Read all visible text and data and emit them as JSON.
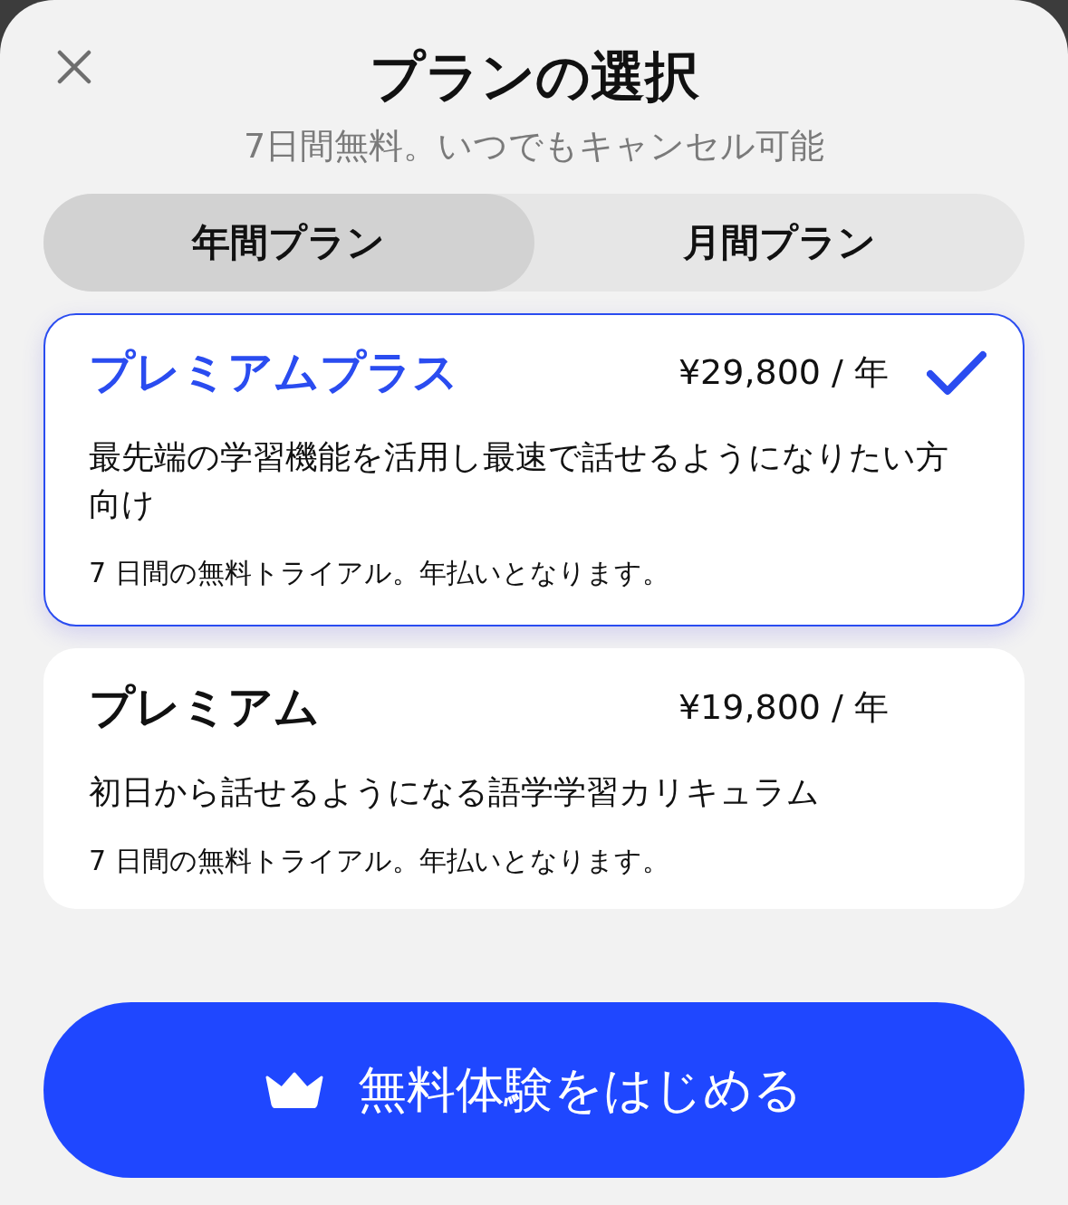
{
  "title": "プランの選択",
  "subtitle": "7日間無料。いつでもキャンセル可能",
  "tabs": [
    {
      "label": "年間プラン",
      "selected": true
    },
    {
      "label": "月間プラン",
      "selected": false
    }
  ],
  "plans": [
    {
      "name": "プレミアムプラス",
      "price": "¥29,800 / 年",
      "description": "最先端の学習機能を活用し最速で話せるようになりたい方向け",
      "note": "7 日間の無料トライアル。年払いとなります。",
      "selected": true
    },
    {
      "name": "プレミアム",
      "price": "¥19,800 / 年",
      "description": "初日から話せるようになる語学学習カリキュラム",
      "note": "7 日間の無料トライアル。年払いとなります。",
      "selected": false
    }
  ],
  "cta": {
    "label": "無料体験をはじめる"
  }
}
